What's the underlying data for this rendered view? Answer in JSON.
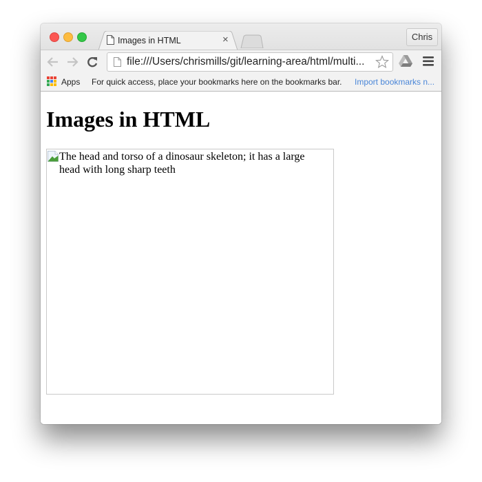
{
  "window": {
    "tabs": [
      {
        "title": "Images in HTML",
        "icon": "page-icon",
        "close_icon": "×"
      }
    ],
    "profile_label": "Chris"
  },
  "toolbar": {
    "back_icon": "arrow-left-icon",
    "forward_icon": "arrow-right-icon",
    "reload_icon": "reload-icon",
    "url": "file:///Users/chrismills/git/learning-area/html/multi...",
    "star_icon": "star-icon",
    "extension_icon": "google-drive-icon",
    "menu_icon": "hamburger-menu-icon"
  },
  "bookmarks": {
    "apps_label": "Apps",
    "hint": "For quick access, place your bookmarks here on the bookmarks bar.",
    "import_link": "Import bookmarks n...",
    "import_color": "#4a86d8"
  },
  "page": {
    "heading": "Images in HTML",
    "image_alt": "The head and torso of a dinosaur skeleton; it has a large head with long sharp teeth",
    "broken_image_icon": "broken-image-icon"
  },
  "colors": {
    "traffic_red": "#fc5753",
    "traffic_yellow": "#fdbc40",
    "traffic_green": "#33c748",
    "apps_grid": [
      "#e94235",
      "#e94235",
      "#4285f4",
      "#34a853",
      "#4285f4",
      "#fbbc05",
      "#34a853",
      "#fbbc05",
      "#fbbc05"
    ]
  }
}
